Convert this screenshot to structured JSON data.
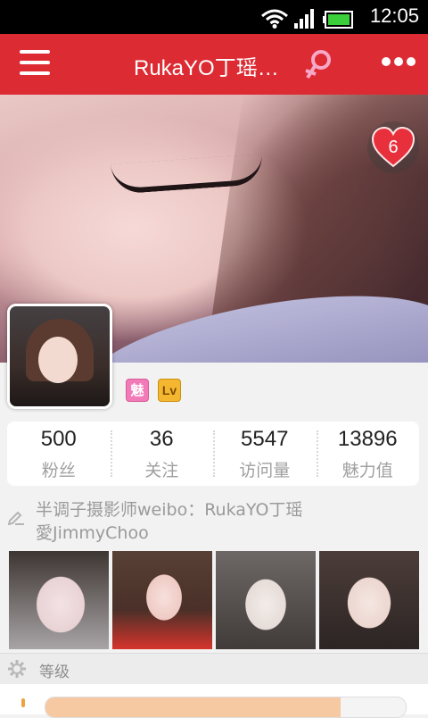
{
  "status_bar": {
    "time": "12:05",
    "icons": [
      "wifi-icon",
      "signal-icon",
      "battery-icon"
    ]
  },
  "header": {
    "title": "RukaYO丁瑶…",
    "gender_icon": "female-icon",
    "menu_icon": "hamburger-icon",
    "more_icon": "more-dots-icon"
  },
  "cover": {
    "heart_count": "6"
  },
  "badges": [
    {
      "text": "魅"
    },
    {
      "text": "Lv"
    }
  ],
  "stats": [
    {
      "value": "500",
      "label": "粉丝"
    },
    {
      "value": "36",
      "label": "关注"
    },
    {
      "value": "5547",
      "label": "访问量"
    },
    {
      "value": "13896",
      "label": "魅力值"
    }
  ],
  "bio": {
    "line1": "半调子摄影师weibo：RukaYO丁瑶",
    "line2": "愛JimmyChoo"
  },
  "section": {
    "label": "等级"
  },
  "level_progress": 0.82,
  "colors": {
    "accent": "#dd2b34",
    "progress": "#f7c9a3"
  }
}
